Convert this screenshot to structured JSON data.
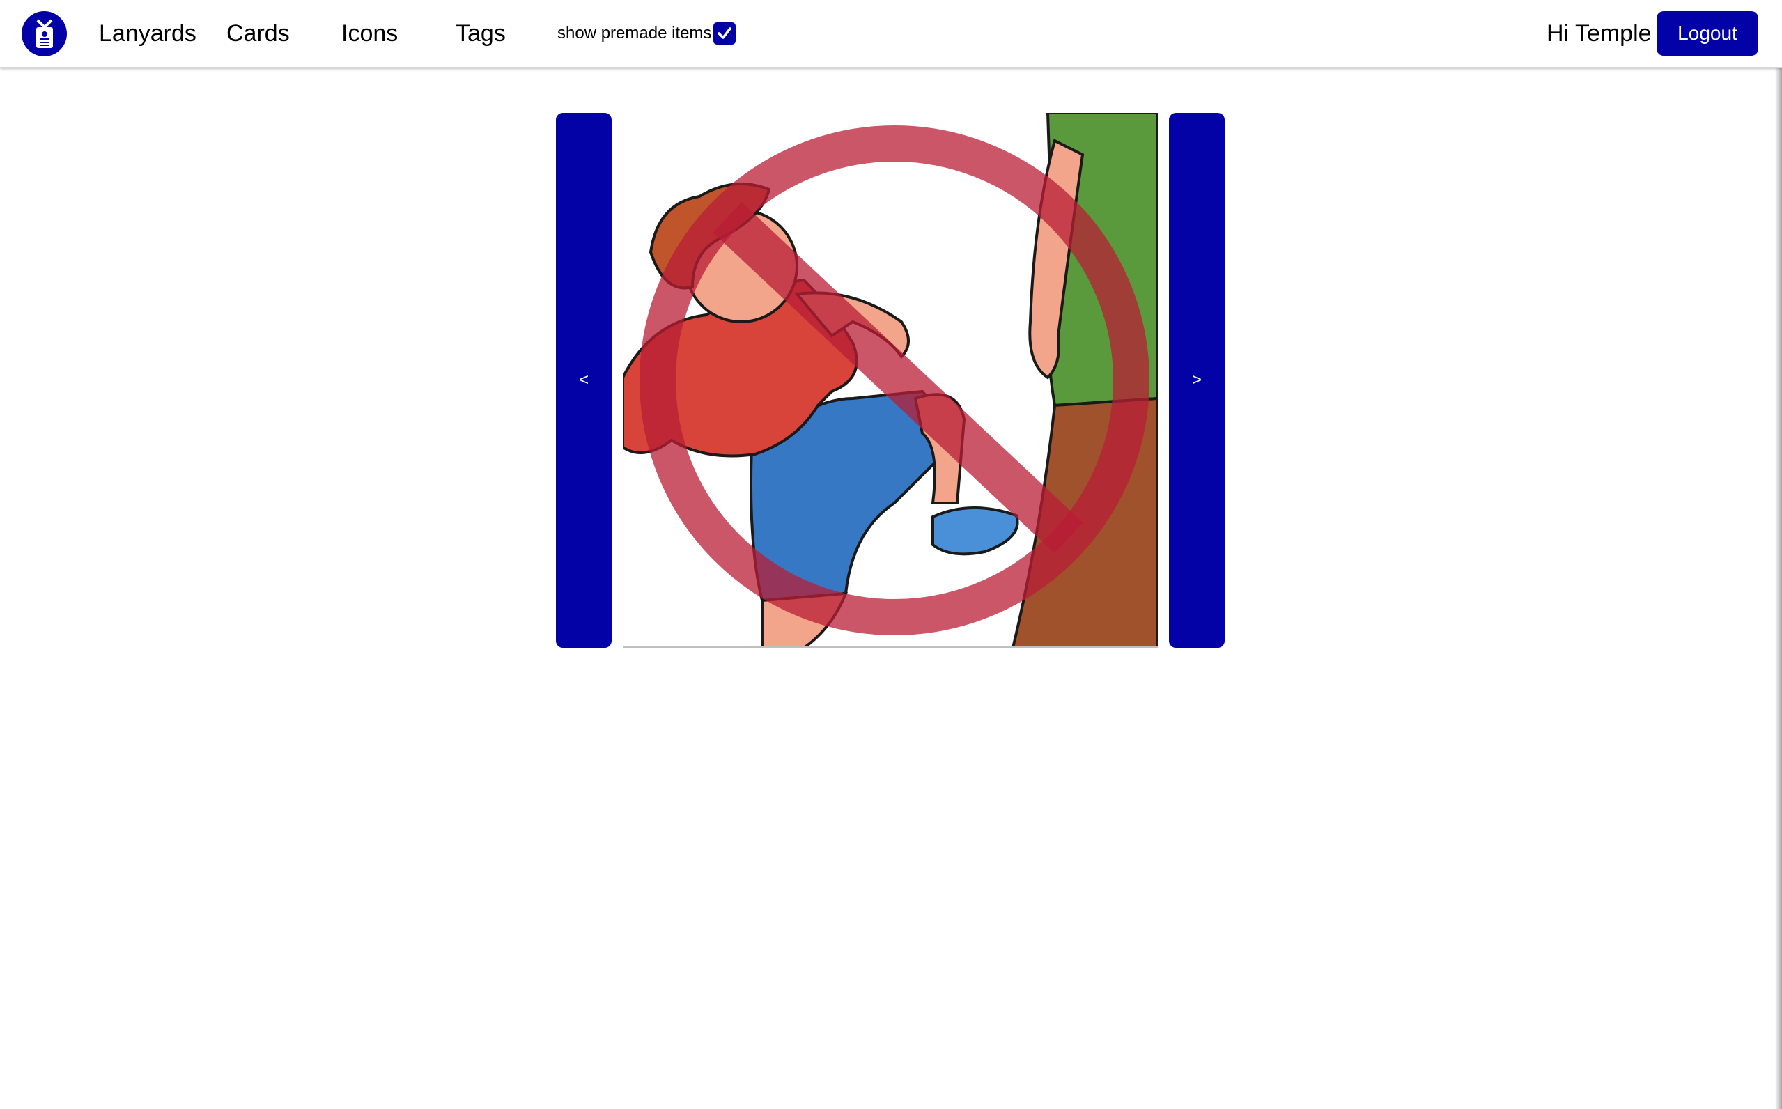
{
  "nav": {
    "links": [
      "Lanyards",
      "Cards",
      "Icons",
      "Tags"
    ],
    "premade_label": "show premade items",
    "premade_checked": true,
    "greeting": "Hi Temple",
    "logout_label": "Logout"
  },
  "carousel": {
    "prev_label": "<",
    "next_label": ">",
    "card_image_icon": "no-kicking-icon"
  },
  "colors": {
    "accent": "#0202a6",
    "prohibition": "#b81e35",
    "shirt": "#d8433a",
    "shorts": "#3778c4",
    "pants": "#5b9a3c"
  },
  "icons": {
    "logo": "lanyard-badge-icon",
    "checkbox": "checkmark-icon"
  }
}
